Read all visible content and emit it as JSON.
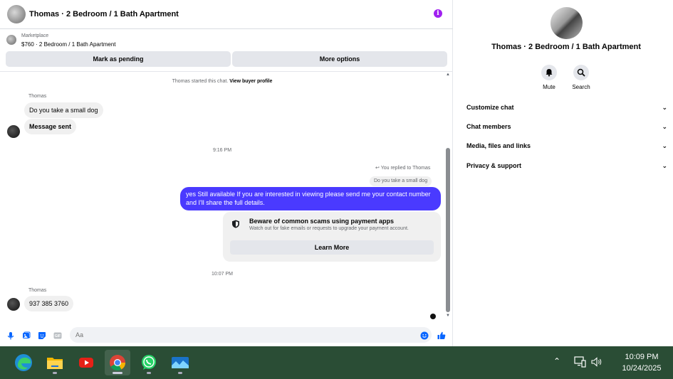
{
  "chat_header": {
    "title": "Thomas · 2 Bedroom / 1 Bath Apartment",
    "info_icon": "info-icon"
  },
  "marketplace": {
    "label": "Marketplace",
    "listing": "$760 · 2 Bedroom / 1 Bath Apartment",
    "mark_pending": "Mark as pending",
    "more_options": "More options"
  },
  "messages": {
    "started": "Thomas started this chat.",
    "view_profile": "View buyer profile",
    "sender1": "Thomas",
    "msg1": "Do you take a small dog",
    "msg2": "Message sent",
    "time1": "9:16 PM",
    "replied_label": "You replied to Thomas",
    "quoted": "Do you take a small dog",
    "outgoing": "yes Still available If you are interested in viewing please send me your contact number and I'll share the full details.",
    "scam_title": "Beware of common scams using payment apps",
    "scam_sub": "Watch out for fake emails or requests to upgrade your payment account.",
    "learn_more": "Learn More",
    "time2": "10:07 PM",
    "sender2": "Thomas",
    "msg3": "937 385 3760"
  },
  "composer": {
    "placeholder": "Aa",
    "icons": [
      "microphone-icon",
      "photo-icon",
      "sticker-icon",
      "gif-icon",
      "emoji-icon",
      "like-icon"
    ]
  },
  "info_panel": {
    "name": "Thomas · 2 Bedroom / 1 Bath Apartment",
    "mute": "Mute",
    "search": "Search",
    "sections": [
      "Customize chat",
      "Chat members",
      "Media, files and links",
      "Privacy & support"
    ]
  },
  "taskbar": {
    "apps": [
      "edge-icon",
      "file-explorer-icon",
      "youtube-icon",
      "chrome-icon",
      "whatsapp-icon",
      "photos-icon"
    ],
    "time": "10:09 PM",
    "date": "10/24/2025"
  },
  "colors": {
    "accent": "#4a3aff",
    "like": "#0866ff",
    "taskbar": "#2a4d35"
  }
}
